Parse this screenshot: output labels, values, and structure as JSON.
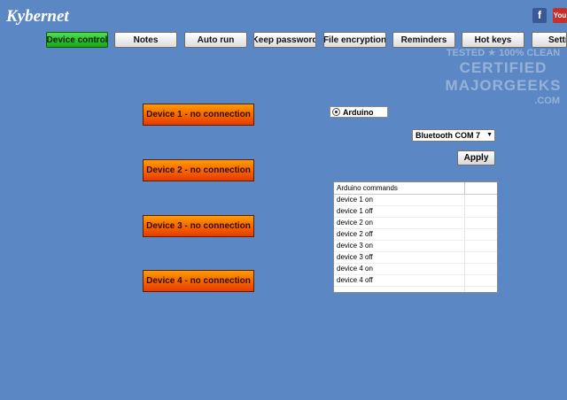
{
  "app": {
    "title": "Kybernet"
  },
  "social": {
    "facebook": "f",
    "youtube": "You"
  },
  "tabs": [
    {
      "label": "Device control"
    },
    {
      "label": "Notes"
    },
    {
      "label": "Auto run"
    },
    {
      "label": "Keep password"
    },
    {
      "label": "File encryption"
    },
    {
      "label": "Reminders"
    },
    {
      "label": "Hot keys"
    },
    {
      "label": "Settings"
    }
  ],
  "watermark": {
    "line1": "TESTED ★ 100% CLEAN",
    "line2": "CERTIFIED",
    "line3": "MAJORGEEKS",
    "line4": ".COM"
  },
  "devices": [
    {
      "label": "Device 1 - no connection"
    },
    {
      "label": "Device 2 - no connection"
    },
    {
      "label": "Device 3 - no connection"
    },
    {
      "label": "Device 4 - no connection"
    }
  ],
  "connection": {
    "radio_label": "Arduino",
    "port_selected": "Bluetooth COM 7",
    "apply_label": "Apply"
  },
  "commands_table": {
    "header": "Arduino commands",
    "rows": [
      "device 1 on",
      "device 1 off",
      "device 2 on",
      "device 2 off",
      "device 3 on",
      "device 3 off",
      "device 4 on",
      "device 4 off",
      ""
    ]
  },
  "colors": {
    "background": "#5b88c4",
    "active_tab": "#17a617",
    "device_button": "#e83a00"
  }
}
